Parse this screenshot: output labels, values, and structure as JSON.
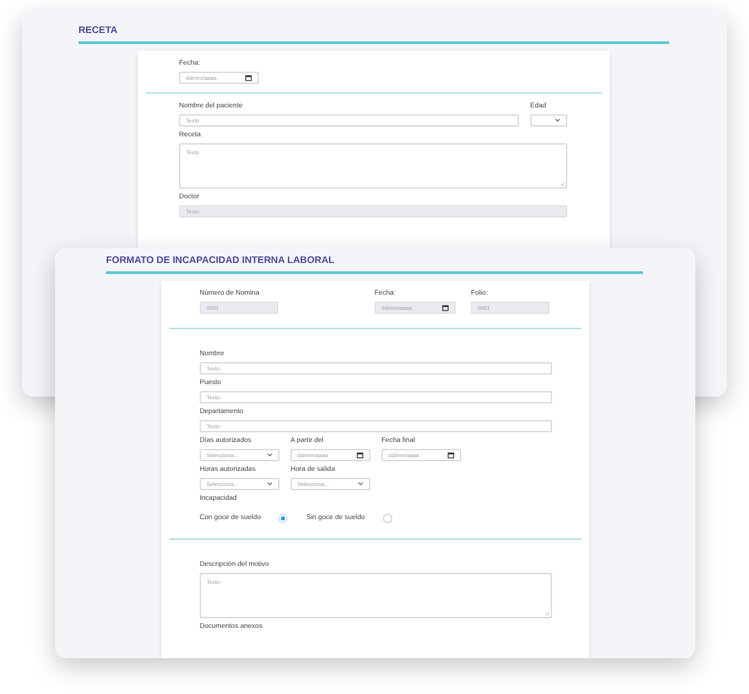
{
  "windows": [
    {
      "title": "RECETA",
      "kind": "back",
      "sections": [
        {
          "rows": [
            {
              "kind": "inline",
              "fields": [
                {
                  "label": "Fecha:",
                  "kind": "date",
                  "value": "dd/mm/aaaa",
                  "disabled": false
                }
              ]
            }
          ]
        },
        {
          "rows": [
            {
              "kind": "split",
              "fields": [
                {
                  "label": "Nombre del paciente",
                  "kind": "text",
                  "placeholder": "Texto",
                  "disabled": false
                },
                {
                  "label": "Edad",
                  "kind": "select",
                  "disabled": false
                }
              ]
            },
            {
              "kind": "stack",
              "fields": [
                {
                  "label": "Receta",
                  "kind": "textarea",
                  "placeholder": "Texto",
                  "disabled": false
                }
              ]
            },
            {
              "kind": "stack",
              "fields": [
                {
                  "label": "Doctor",
                  "kind": "text",
                  "placeholder": "Texto",
                  "disabled": true
                }
              ]
            }
          ]
        }
      ]
    },
    {
      "title": "FORMATO DE INCAPACIDAD INTERNA LABORAL",
      "kind": "front",
      "sections": [
        {
          "rows": [
            {
              "kind": "spread",
              "fields": [
                {
                  "label": "Número de Nomina",
                  "kind": "text",
                  "value": "0001",
                  "disabled": true
                },
                {
                  "label": "Fecha:",
                  "kind": "date",
                  "value": "dd/mm/aaaa",
                  "disabled": true
                },
                {
                  "label": "Folio:",
                  "kind": "text",
                  "value": "0001",
                  "disabled": true
                }
              ]
            }
          ]
        },
        {
          "rows": [
            {
              "kind": "stack",
              "fields": [
                {
                  "label": "Nombre",
                  "kind": "text",
                  "placeholder": "Texto",
                  "disabled": false
                }
              ]
            },
            {
              "kind": "stack",
              "fields": [
                {
                  "label": "Puesto",
                  "kind": "text",
                  "placeholder": "Texto",
                  "disabled": false
                }
              ]
            },
            {
              "kind": "stack",
              "fields": [
                {
                  "label": "Departamento",
                  "kind": "text",
                  "placeholder": "Texto",
                  "disabled": false
                }
              ]
            },
            {
              "kind": "inline",
              "fields": [
                {
                  "label": "Días autorizados",
                  "kind": "select",
                  "placeholder": "Selecciona...",
                  "disabled": false
                },
                {
                  "label": "A partir del",
                  "kind": "date",
                  "value": "dd/mm/aaaa",
                  "disabled": false
                },
                {
                  "label": "Fecha final",
                  "kind": "date",
                  "value": "dd/mm/aaaa",
                  "disabled": false
                }
              ]
            },
            {
              "kind": "inline",
              "fields": [
                {
                  "label": "Horas autorizadas",
                  "kind": "select",
                  "placeholder": "Selecciona...",
                  "disabled": false
                },
                {
                  "label": "Hora de salida",
                  "kind": "select",
                  "placeholder": "Selecciona...",
                  "disabled": false
                }
              ]
            },
            {
              "kind": "stack",
              "fields": [
                {
                  "label": "Incapacidad",
                  "kind": "radio",
                  "options": [
                    {
                      "label": "Con goce de sueldo",
                      "selected": true
                    },
                    {
                      "label": "Sin goce de sueldo",
                      "selected": false
                    }
                  ]
                }
              ]
            }
          ]
        },
        {
          "rows": [
            {
              "kind": "stack",
              "fields": [
                {
                  "label": "Descripción del motivo",
                  "kind": "textarea",
                  "placeholder": "Texto",
                  "disabled": false
                }
              ]
            },
            {
              "kind": "stack",
              "fields": [
                {
                  "label": "Documentos anexos",
                  "kind": "label"
                }
              ]
            }
          ]
        }
      ]
    }
  ]
}
